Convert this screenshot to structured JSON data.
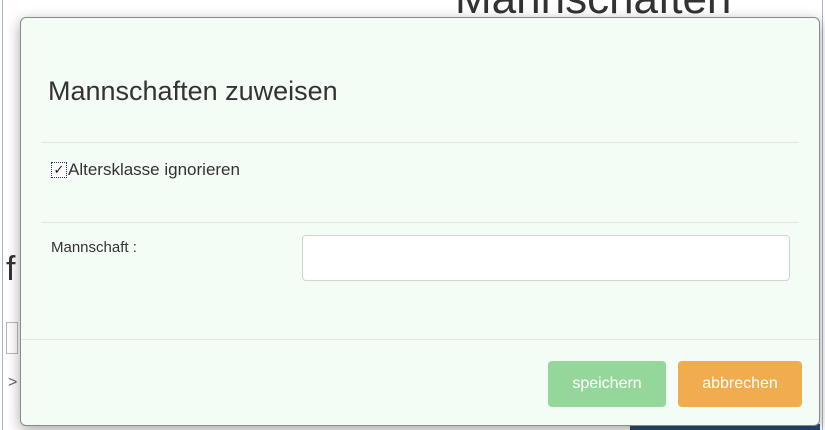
{
  "background": {
    "heading": "Mannschaften",
    "partial_letter": "f",
    "glyph": ">"
  },
  "modal": {
    "title": "Mannschaften zuweisen",
    "checkbox": {
      "label": "Altersklasse ignorieren",
      "checked": true,
      "check_glyph": "✓"
    },
    "team_field": {
      "label": "Mannschaft :",
      "value": "",
      "placeholder": ""
    },
    "buttons": {
      "save_label": "speichern",
      "cancel_label": "abbrechen"
    }
  },
  "colors": {
    "modal_background": "#f3fdf6",
    "save_button": "#95d79a",
    "cancel_button": "#f1ac4f",
    "text": "#333333"
  }
}
